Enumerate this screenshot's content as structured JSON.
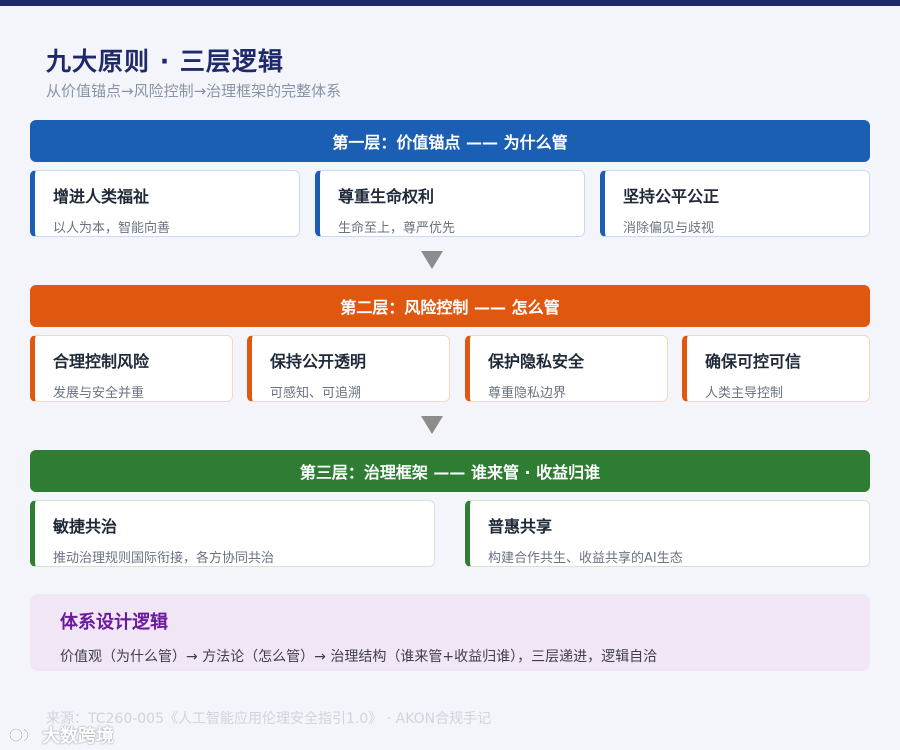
{
  "page": {
    "title": "九大原则 · 三层逻辑",
    "subtitle": "从价值锚点→风险控制→治理框架的完整体系"
  },
  "layers": [
    {
      "header": "第一层：价值锚点 —— 为什么管",
      "color": "#1a5fb4",
      "cards": [
        {
          "title": "增进人类福祉",
          "desc": "以人为本，智能向善"
        },
        {
          "title": "尊重生命权利",
          "desc": "生命至上，尊严优先"
        },
        {
          "title": "坚持公平公正",
          "desc": "消除偏见与歧视"
        }
      ]
    },
    {
      "header": "第二层：风险控制 —— 怎么管",
      "color": "#e0570f",
      "cards": [
        {
          "title": "合理控制风险",
          "desc": "发展与安全并重"
        },
        {
          "title": "保持公开透明",
          "desc": "可感知、可追溯"
        },
        {
          "title": "保护隐私安全",
          "desc": "尊重隐私边界"
        },
        {
          "title": "确保可控可信",
          "desc": "人类主导控制"
        }
      ]
    },
    {
      "header": "第三层：治理框架 —— 谁来管 · 收益归谁",
      "color": "#2e7d32",
      "cards": [
        {
          "title": "敏捷共治",
          "desc": "推动治理规则国际衔接，各方协同共治"
        },
        {
          "title": "普惠共享",
          "desc": "构建合作共生、收益共享的AI生态"
        }
      ]
    }
  ],
  "logic": {
    "title": "体系设计逻辑",
    "text": "价值观（为什么管）→ 方法论（怎么管）→ 治理结构（谁来管+收益归谁），三层递进，逻辑自洽"
  },
  "source": "来源：TC260-005《人工智能应用伦理安全指引1.0》 · AKON合规手记",
  "watermark": "大数跨境"
}
